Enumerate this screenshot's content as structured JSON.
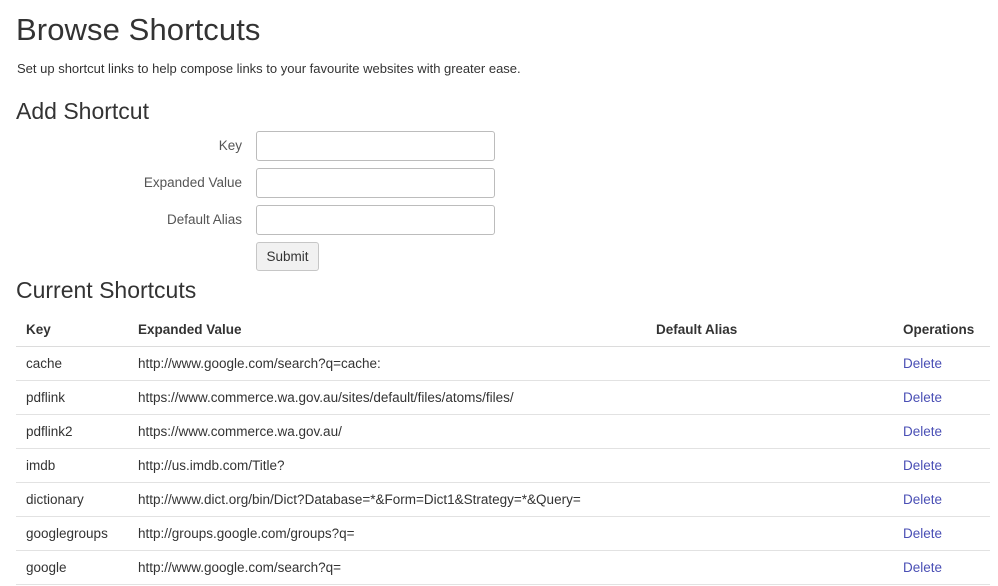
{
  "header": {
    "title": "Browse Shortcuts",
    "subtitle": "Set up shortcut links to help compose links to your favourite websites with greater ease."
  },
  "add_section": {
    "title": "Add Shortcut",
    "fields": [
      {
        "label": "Key",
        "value": "",
        "placeholder": ""
      },
      {
        "label": "Expanded Value",
        "value": "",
        "placeholder": ""
      },
      {
        "label": "Default Alias",
        "value": "",
        "placeholder": ""
      }
    ],
    "submit_label": "Submit"
  },
  "current_section": {
    "title": "Current Shortcuts",
    "columns": [
      "Key",
      "Expanded Value",
      "Default Alias",
      "Operations"
    ],
    "rows": [
      {
        "key": "cache",
        "expanded": "http://www.google.com/search?q=cache:",
        "alias": "",
        "op": "Delete"
      },
      {
        "key": "pdflink",
        "expanded": "https://www.commerce.wa.gov.au/sites/default/files/atoms/files/",
        "alias": "",
        "op": "Delete"
      },
      {
        "key": "pdflink2",
        "expanded": "https://www.commerce.wa.gov.au/",
        "alias": "",
        "op": "Delete"
      },
      {
        "key": "imdb",
        "expanded": "http://us.imdb.com/Title?",
        "alias": "",
        "op": "Delete"
      },
      {
        "key": "dictionary",
        "expanded": "http://www.dict.org/bin/Dict?Database=*&Form=Dict1&Strategy=*&Query=",
        "alias": "",
        "op": "Delete"
      },
      {
        "key": "googlegroups",
        "expanded": "http://groups.google.com/groups?q=",
        "alias": "",
        "op": "Delete"
      },
      {
        "key": "google",
        "expanded": "http://www.google.com/search?q=",
        "alias": "",
        "op": "Delete"
      }
    ]
  },
  "colors": {
    "link": "#4a4fb5",
    "text": "#333333",
    "border": "#dcdcdc"
  }
}
